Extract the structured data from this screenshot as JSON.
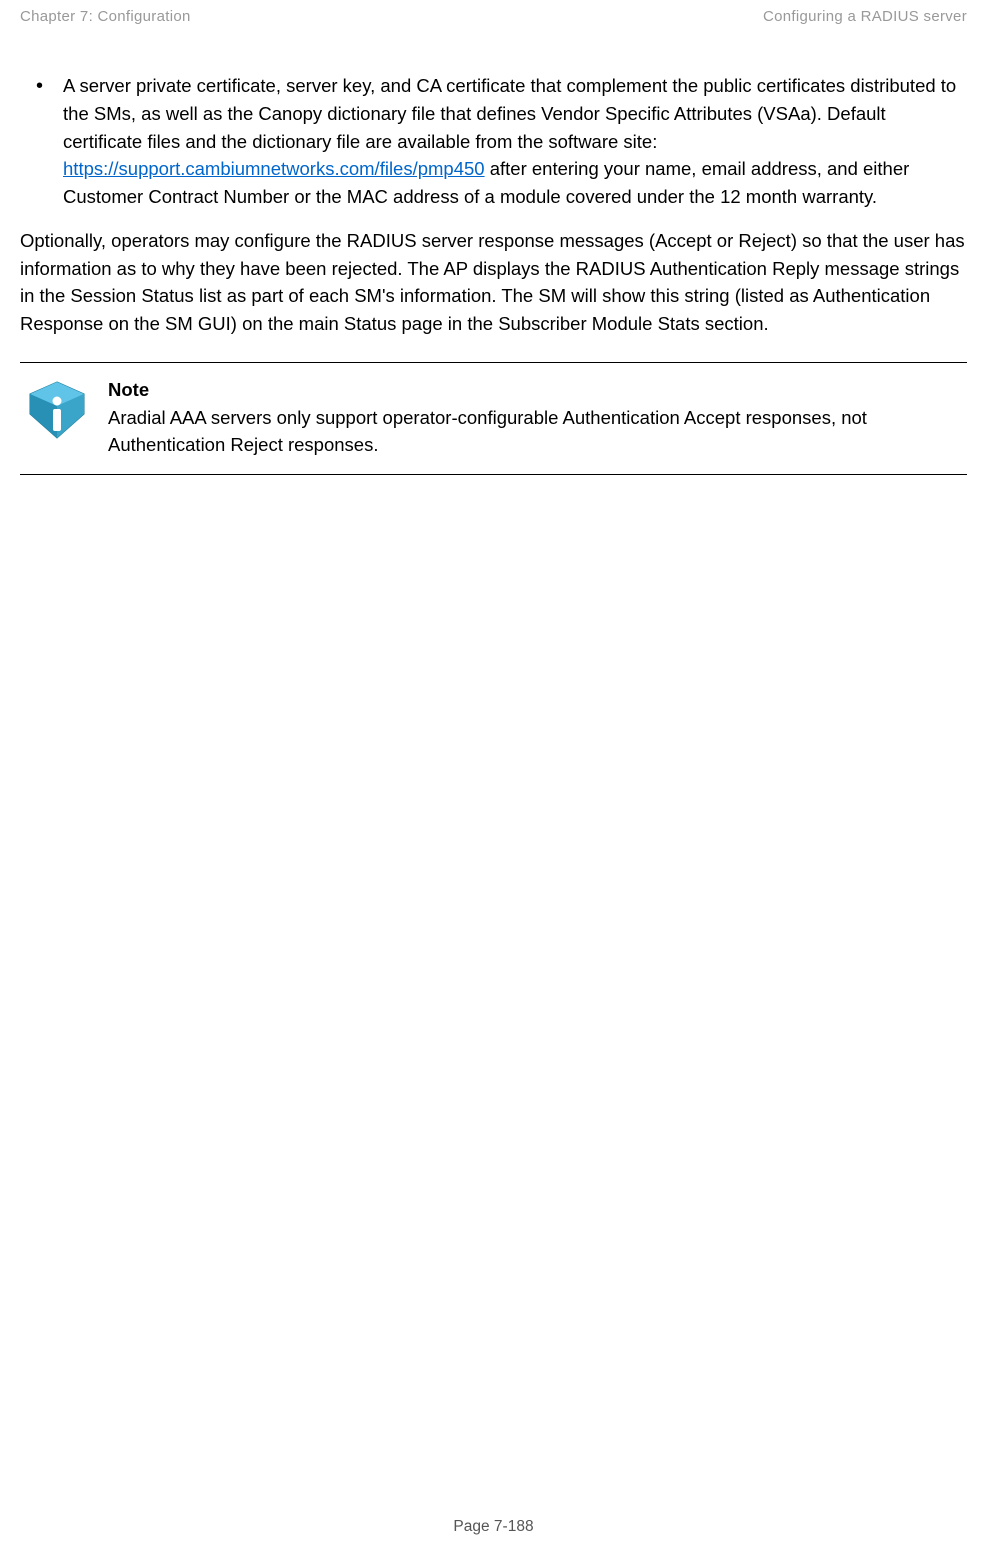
{
  "header": {
    "left": "Chapter 7:  Configuration",
    "right": "Configuring a RADIUS server"
  },
  "bullet": {
    "text_before_link": "A server private certificate, server key, and CA certificate that complement the public certificates distributed to the SMs, as well as the Canopy dictionary file that defines Vendor Specific Attributes (VSAa). Default certificate files and the dictionary file are available from the software site: ",
    "link_text": "https://support.cambiumnetworks.com/files/pmp450",
    "text_after_link": " after entering your name, email address, and either Customer Contract Number or the MAC address of a module covered under the 12 month warranty."
  },
  "paragraph": "Optionally, operators may configure the RADIUS server response messages (Accept or Reject) so that the user has information as to why they have been rejected.  The AP displays the RADIUS Authentication Reply message strings in the Session Status list as part of each SM's information. The SM will show this string (listed as Authentication Response on the SM GUI) on the main Status page in the Subscriber Module Stats section.",
  "note": {
    "title": "Note",
    "text": "Aradial AAA servers only support operator-configurable Authentication Accept responses, not Authentication Reject responses."
  },
  "footer": "Page 7-188"
}
